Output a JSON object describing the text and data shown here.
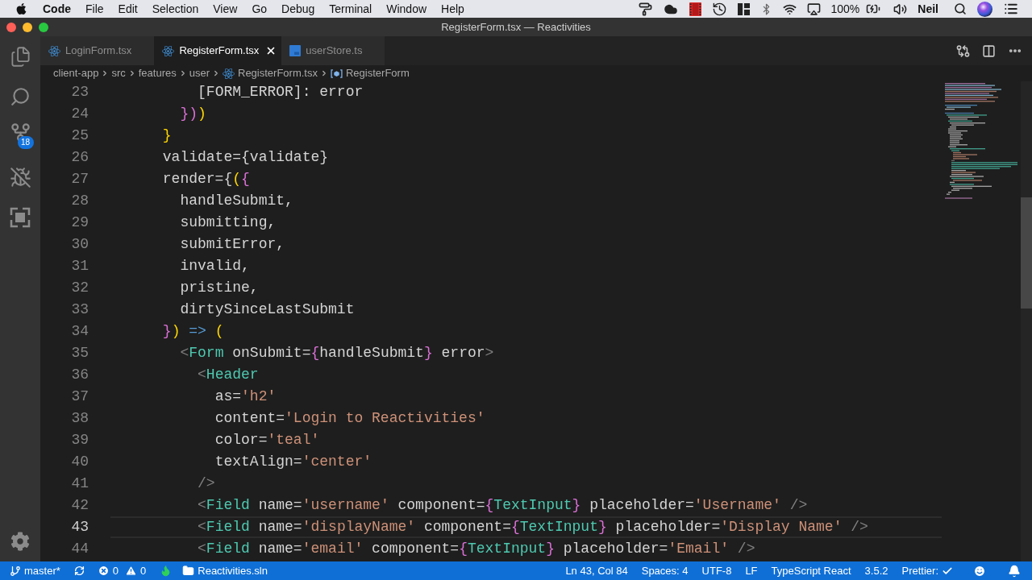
{
  "menu_bar": {
    "app_name": "Code",
    "menus": [
      "File",
      "Edit",
      "Selection",
      "View",
      "Go",
      "Debug",
      "Terminal",
      "Window",
      "Help"
    ],
    "battery": "100%",
    "user": "Neil"
  },
  "window": {
    "title": "RegisterForm.tsx — Reactivities"
  },
  "activity_bar": {
    "source_control_badge": "18"
  },
  "tabs": [
    {
      "label": "LoginForm.tsx",
      "kind": "react",
      "selected": false
    },
    {
      "label": "RegisterForm.tsx",
      "kind": "react",
      "selected": true
    },
    {
      "label": "userStore.ts",
      "kind": "typescript",
      "selected": false
    }
  ],
  "breadcrumb": [
    {
      "label": "client-app",
      "kind": "folder"
    },
    {
      "label": "src",
      "kind": "folder"
    },
    {
      "label": "features",
      "kind": "folder"
    },
    {
      "label": "user",
      "kind": "folder"
    },
    {
      "label": "RegisterForm.tsx",
      "kind": "react-file"
    },
    {
      "label": "RegisterForm",
      "kind": "symbol"
    }
  ],
  "editor": {
    "lines": [
      {
        "number": "23",
        "current": false,
        "tokens": [
          {
            "text": "          [FORM_ERROR]: error",
            "kind": "plain"
          }
        ]
      },
      {
        "number": "24",
        "current": false,
        "tokens": [
          {
            "text": "        })",
            "kind": "orchid"
          },
          {
            "text": ")",
            "kind": "gold"
          }
        ]
      },
      {
        "number": "25",
        "current": false,
        "tokens": [
          {
            "text": "      }",
            "kind": "gold"
          }
        ]
      },
      {
        "number": "26",
        "current": false,
        "tokens": [
          {
            "text": "      validate={validate}",
            "kind": "plain"
          }
        ]
      },
      {
        "number": "27",
        "current": false,
        "tokens": [
          {
            "text": "      render={",
            "kind": "plain"
          },
          {
            "text": "(",
            "kind": "gold"
          },
          {
            "text": "{",
            "kind": "orchid"
          }
        ]
      },
      {
        "number": "28",
        "current": false,
        "tokens": [
          {
            "text": "        handleSubmit,",
            "kind": "plain"
          }
        ]
      },
      {
        "number": "29",
        "current": false,
        "tokens": [
          {
            "text": "        submitting,",
            "kind": "plain"
          }
        ]
      },
      {
        "number": "30",
        "current": false,
        "tokens": [
          {
            "text": "        submitError,",
            "kind": "plain"
          }
        ]
      },
      {
        "number": "31",
        "current": false,
        "tokens": [
          {
            "text": "        invalid,",
            "kind": "plain"
          }
        ]
      },
      {
        "number": "32",
        "current": false,
        "tokens": [
          {
            "text": "        pristine,",
            "kind": "plain"
          }
        ]
      },
      {
        "number": "33",
        "current": false,
        "tokens": [
          {
            "text": "        dirtySinceLastSubmit",
            "kind": "plain"
          }
        ]
      },
      {
        "number": "34",
        "current": false,
        "tokens": [
          {
            "text": "      }",
            "kind": "orchid"
          },
          {
            "text": ")",
            "kind": "gold"
          },
          {
            "text": " => ",
            "kind": "keyword"
          },
          {
            "text": "(",
            "kind": "gold"
          }
        ]
      },
      {
        "number": "35",
        "current": false,
        "tokens": [
          {
            "text": "        <",
            "kind": "punct"
          },
          {
            "text": "Form",
            "kind": "tag"
          },
          {
            "text": " onSubmit=",
            "kind": "plain"
          },
          {
            "text": "{",
            "kind": "orchid"
          },
          {
            "text": "handleSubmit",
            "kind": "plain"
          },
          {
            "text": "}",
            "kind": "orchid"
          },
          {
            "text": " error",
            "kind": "plain"
          },
          {
            "text": ">",
            "kind": "punct"
          }
        ]
      },
      {
        "number": "36",
        "current": false,
        "tokens": [
          {
            "text": "          <",
            "kind": "punct"
          },
          {
            "text": "Header",
            "kind": "tag"
          }
        ]
      },
      {
        "number": "37",
        "current": false,
        "tokens": [
          {
            "text": "            as=",
            "kind": "plain"
          },
          {
            "text": "'h2'",
            "kind": "string"
          }
        ]
      },
      {
        "number": "38",
        "current": false,
        "tokens": [
          {
            "text": "            content=",
            "kind": "plain"
          },
          {
            "text": "'Login to Reactivities'",
            "kind": "string"
          }
        ]
      },
      {
        "number": "39",
        "current": false,
        "tokens": [
          {
            "text": "            color=",
            "kind": "plain"
          },
          {
            "text": "'teal'",
            "kind": "string"
          }
        ]
      },
      {
        "number": "40",
        "current": false,
        "tokens": [
          {
            "text": "            textAlign=",
            "kind": "plain"
          },
          {
            "text": "'center'",
            "kind": "string"
          }
        ]
      },
      {
        "number": "41",
        "current": false,
        "tokens": [
          {
            "text": "          />",
            "kind": "punct"
          }
        ]
      },
      {
        "number": "42",
        "current": false,
        "tokens": [
          {
            "text": "          <",
            "kind": "punct"
          },
          {
            "text": "Field",
            "kind": "tag"
          },
          {
            "text": " name=",
            "kind": "plain"
          },
          {
            "text": "'username'",
            "kind": "string"
          },
          {
            "text": " component=",
            "kind": "plain"
          },
          {
            "text": "{",
            "kind": "orchid"
          },
          {
            "text": "TextInput",
            "kind": "tag"
          },
          {
            "text": "}",
            "kind": "orchid"
          },
          {
            "text": " placeholder=",
            "kind": "plain"
          },
          {
            "text": "'Username'",
            "kind": "string"
          },
          {
            "text": " />",
            "kind": "punct"
          }
        ]
      },
      {
        "number": "43",
        "current": true,
        "tokens": [
          {
            "text": "          <",
            "kind": "punct"
          },
          {
            "text": "Field",
            "kind": "tag"
          },
          {
            "text": " name=",
            "kind": "plain"
          },
          {
            "text": "'displayName'",
            "kind": "string"
          },
          {
            "text": " component=",
            "kind": "plain"
          },
          {
            "text": "{",
            "kind": "orchid"
          },
          {
            "text": "TextInput",
            "kind": "tag"
          },
          {
            "text": "}",
            "kind": "orchid"
          },
          {
            "text": " placeholder=",
            "kind": "plain"
          },
          {
            "text": "'Display Name'",
            "kind": "string"
          },
          {
            "text": " />",
            "kind": "punct"
          }
        ]
      },
      {
        "number": "44",
        "current": false,
        "tokens": [
          {
            "text": "          <",
            "kind": "punct"
          },
          {
            "text": "Field",
            "kind": "tag"
          },
          {
            "text": " name=",
            "kind": "plain"
          },
          {
            "text": "'email'",
            "kind": "string"
          },
          {
            "text": " component=",
            "kind": "plain"
          },
          {
            "text": "{",
            "kind": "orchid"
          },
          {
            "text": "TextInput",
            "kind": "tag"
          },
          {
            "text": "}",
            "kind": "orchid"
          },
          {
            "text": " placeholder=",
            "kind": "plain"
          },
          {
            "text": "'Email'",
            "kind": "string"
          },
          {
            "text": " />",
            "kind": "punct"
          }
        ]
      }
    ]
  },
  "status_bar": {
    "branch": "master*",
    "errors": "0",
    "warnings": "0",
    "solution": "Reactivities.sln",
    "position": "Ln 43, Col 84",
    "indentation": "Spaces: 4",
    "encoding": "UTF-8",
    "line_ending": "LF",
    "language": "TypeScript React",
    "version": "3.5.2",
    "formatter": "Prettier:"
  }
}
